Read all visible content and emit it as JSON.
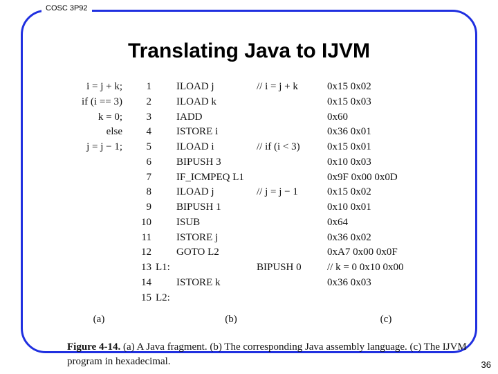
{
  "course": "COSC 3P92",
  "title": "Translating Java to IJVM",
  "page_number": "36",
  "colA": [
    "i = j + k;",
    "if (i == 3)",
    "k = 0;",
    "else",
    "j = j − 1;",
    "",
    "",
    "",
    "",
    "",
    "",
    "",
    "",
    "",
    ""
  ],
  "lineNums": [
    "1",
    "2",
    "3",
    "4",
    "5",
    "6",
    "7",
    "8",
    "9",
    "10",
    "11",
    "12",
    "13",
    "14",
    "15"
  ],
  "labelsCol": [
    "",
    "",
    "",
    "",
    "",
    "",
    "",
    "",
    "",
    "",
    "",
    "",
    "L1:",
    "",
    "L2:"
  ],
  "instr": [
    "ILOAD j",
    "ILOAD k",
    "IADD",
    "ISTORE i",
    "ILOAD i",
    "BIPUSH 3",
    "IF_ICMPEQ L1",
    "ILOAD j",
    "BIPUSH 1",
    "ISUB",
    "ISTORE j",
    "GOTO L2",
    "",
    "ISTORE k",
    ""
  ],
  "instrRight": "BIPUSH 0",
  "comments": [
    "// i = j + k",
    "",
    "",
    "",
    "// if (i < 3)",
    "",
    "",
    "// j = j − 1",
    "",
    "",
    "",
    "",
    "",
    "",
    ""
  ],
  "hex": [
    "0x15 0x02",
    "0x15 0x03",
    "0x60",
    "0x36 0x01",
    "0x15 0x01",
    "0x10 0x03",
    "0x9F 0x00 0x0D",
    "0x15 0x02",
    "0x10 0x01",
    "0x64",
    "0x36 0x02",
    "0xA7 0x00 0x0F",
    "// k = 0 0x10 0x00",
    "0x36 0x03",
    ""
  ],
  "partLabels": {
    "a": "(a)",
    "b": "(b)",
    "c": "(c)"
  },
  "caption": {
    "label": "Figure 4-14.",
    "text": " (a) A Java fragment. (b) The corresponding Java assembly language. (c) The IJVM program in hexadecimal."
  }
}
